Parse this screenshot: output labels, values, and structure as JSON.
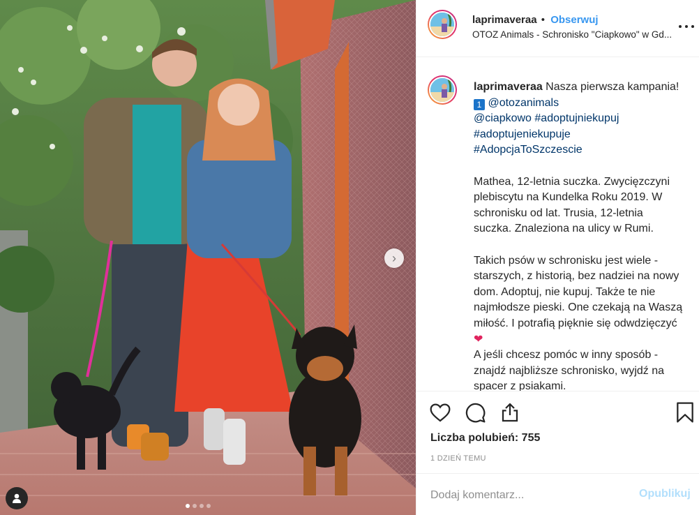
{
  "header": {
    "username": "laprimaveraa",
    "separator": "•",
    "follow_label": "Obserwuj",
    "location": "OTOZ Animals - Schronisko \"Ciapkowo\" w Gd..."
  },
  "caption": {
    "username": "laprimaveraa",
    "intro": " Nasza pierwsza kampania! ",
    "emoji": "1",
    "space": " ",
    "tags": [
      "@otozanimals",
      "@ciapkowo",
      "#adoptujniekupuj",
      "#adoptujeniekupuje",
      "#AdopcjaToSzczescie"
    ],
    "paragraph_1": "Mathea, 12-letnia suczka. Zwycięzczyni plebiscytu na Kundelka Roku 2019. W schronisku od lat. Trusia, 12-letnia suczka. Znaleziona na ulicy w Rumi.",
    "paragraph_2": "Takich psów w schronisku jest wiele - starszych, z historią, bez nadziei na nowy dom. Adoptuj, nie kupuj. Także te nie najmłodsze pieski. One czekają na Waszą miłość. I potrafią pięknie się odwdzięczyć ",
    "heart_emoji": "❤",
    "paragraph_3": "A jeśli chcesz pomóc w inny sposób - znajdź najbliższe schronisko, wyjdź na spacer z psiakami."
  },
  "actions": {
    "icons": [
      "heart-icon",
      "comment-icon",
      "share-icon",
      "bookmark-icon"
    ],
    "likes_label": "Liczba polubień: 755",
    "timestamp": "1 DZIEŃ TEMU"
  },
  "comment": {
    "placeholder": "Dodaj komentarz...",
    "post_label": "Opublikuj"
  },
  "carousel": {
    "next_icon": "›",
    "dots": 4,
    "active_dot": 1
  },
  "colors": {
    "link": "#003569",
    "follow": "#3897f0",
    "post_disabled": "#b2dffc",
    "text": "#262626",
    "muted": "#8e8e8e"
  }
}
